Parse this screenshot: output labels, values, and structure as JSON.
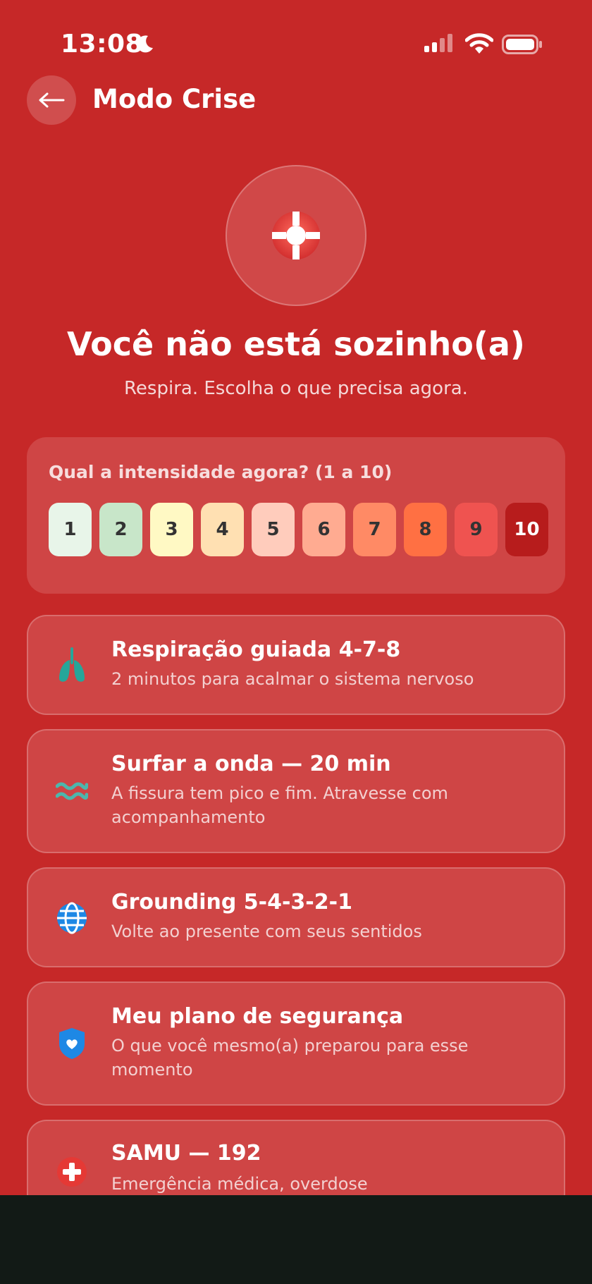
{
  "status_bar": {
    "time": "13:08"
  },
  "header": {
    "title": "Modo Crise"
  },
  "hero": {
    "title": "Você não está sozinho(a)",
    "subtitle": "Respira. Escolha o que precisa agora."
  },
  "intensity": {
    "label": "Qual a intensidade agora? (1 a 10)",
    "levels": [
      "1",
      "2",
      "3",
      "4",
      "5",
      "6",
      "7",
      "8",
      "9",
      "10"
    ],
    "colors": [
      "#e8f5e9",
      "#c8e6c9",
      "#fff9c4",
      "#ffe0b2",
      "#ffccbc",
      "#ffab91",
      "#ff8a65",
      "#ff7043",
      "#ef5350",
      "#b71c1c"
    ],
    "selected": "10"
  },
  "options": [
    {
      "icon": "lungs-icon",
      "title": "Respiração guiada 4-7-8",
      "desc": "2 minutos para acalmar o sistema nervoso"
    },
    {
      "icon": "wave-icon",
      "title": "Surfar a onda — 20 min",
      "desc": "A fissura tem pico e fim. Atravesse com acompanhamento"
    },
    {
      "icon": "globe-icon",
      "title": "Grounding 5-4-3-2-1",
      "desc": "Volte ao presente com seus sentidos"
    },
    {
      "icon": "shield-heart-icon",
      "title": "Meu plano de segurança",
      "desc": "O que você mesmo(a) preparou para esse momento"
    },
    {
      "icon": "medical-cross-icon",
      "title": "SAMU — 192",
      "desc": "Emergência médica, overdose"
    }
  ],
  "colors": {
    "background": "#c62828",
    "card": "#cf4545",
    "nav_bar": "#121a16"
  }
}
